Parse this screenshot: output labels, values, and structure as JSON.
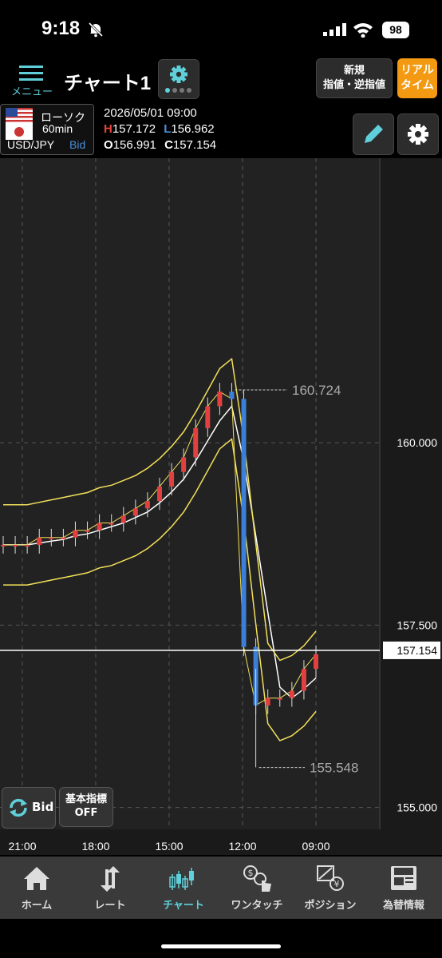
{
  "status_bar": {
    "time": "9:18",
    "battery": "98"
  },
  "header": {
    "menu_label": "メニュー",
    "title": "チャート1",
    "new_order_line1": "新規",
    "new_order_line2": "指値・逆指値",
    "realtime_line1": "リアル",
    "realtime_line2": "タイム"
  },
  "info": {
    "chart_type": "ローソク",
    "interval": "60min",
    "pair": "USD/JPY",
    "side": "Bid",
    "datetime": "2026/05/01 09:00",
    "high_label": "H",
    "high": "157.172",
    "low_label": "L",
    "low": "156.962",
    "open_label": "O",
    "open": "156.991",
    "close_label": "C",
    "close": "157.154"
  },
  "chart_data": {
    "type": "line",
    "title": "",
    "price_labels": [
      "160.000",
      "157.500",
      "155.000"
    ],
    "current_price": "157.154",
    "time_labels": [
      "21:00",
      "18:00",
      "15:00",
      "12:00",
      "09:00"
    ],
    "annotations": [
      {
        "label": "160.724"
      },
      {
        "label": "155.548"
      }
    ],
    "ylim": [
      154.7,
      163.9
    ],
    "series": [
      {
        "values": [
          158.6,
          158.6,
          158.6,
          158.7,
          158.7,
          158.7,
          158.8,
          158.8,
          158.9,
          158.9,
          159.0,
          159.1,
          159.2,
          159.4,
          159.6,
          159.8,
          160.2,
          160.5,
          160.7,
          160.6,
          157.2,
          156.4,
          156.5,
          156.5,
          156.6,
          156.9,
          157.1
        ]
      }
    ],
    "x_count": 27,
    "colors": {
      "up": "#e24040",
      "down": "#3b7fd9",
      "bollinger": "#f2e05a",
      "ma": "#ffffff",
      "grid": "#555555"
    }
  },
  "overlay": {
    "bid_toggle": "Bid",
    "basic_line1": "基本指標",
    "basic_line2": "OFF"
  },
  "tabs": [
    {
      "label": "ホーム",
      "icon": "home-icon"
    },
    {
      "label": "レート",
      "icon": "rate-icon"
    },
    {
      "label": "チャート",
      "icon": "chart-icon"
    },
    {
      "label": "ワンタッチ",
      "icon": "one-touch-icon"
    },
    {
      "label": "ポジション",
      "icon": "position-icon"
    },
    {
      "label": "為替情報",
      "icon": "news-icon"
    }
  ],
  "active_tab": "チャート"
}
